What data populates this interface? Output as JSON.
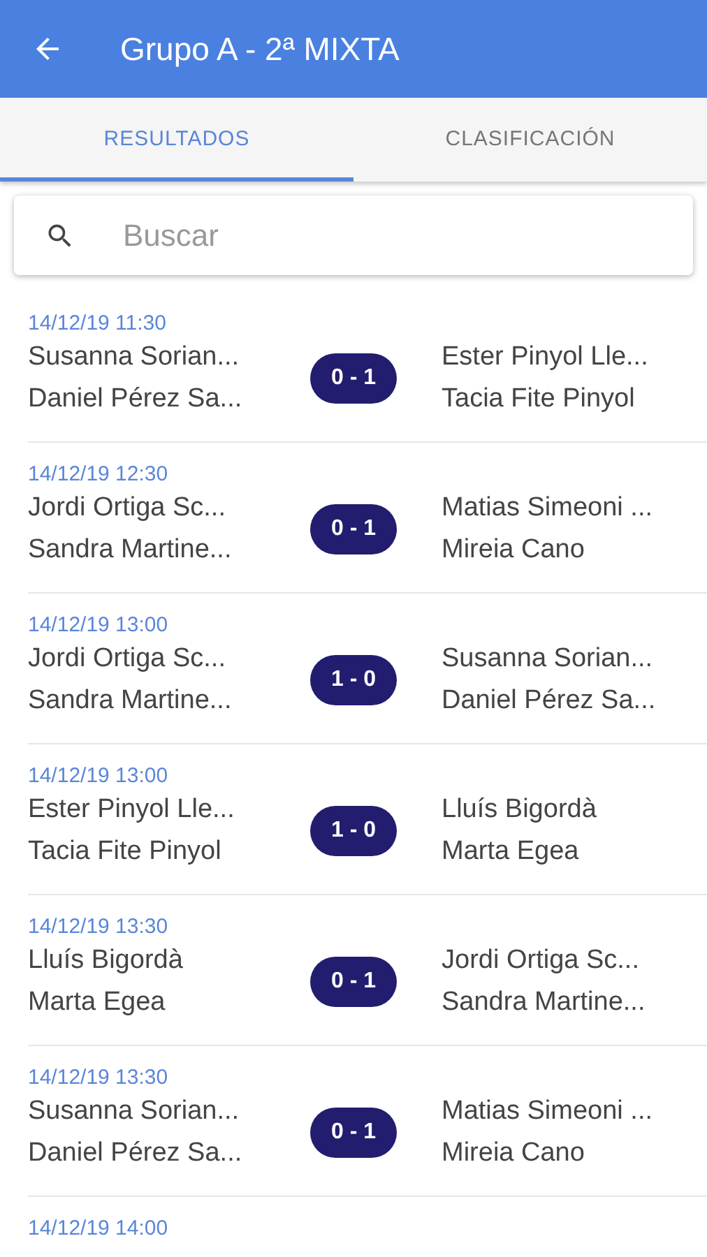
{
  "app_bar": {
    "title": "Grupo A - 2ª MIXTA"
  },
  "tabs": [
    {
      "label": "RESULTADOS",
      "selected": true
    },
    {
      "label": "CLASIFICACIÓN",
      "selected": false
    }
  ],
  "search": {
    "placeholder": "Buscar"
  },
  "matches": [
    {
      "datetime": "14/12/19 11:30",
      "home": [
        "Susanna Sorian...",
        "Daniel Pérez Sa..."
      ],
      "score": "0 - 1",
      "away": [
        "Ester Pinyol Lle...",
        "Tacia Fite Pinyol"
      ]
    },
    {
      "datetime": "14/12/19 12:30",
      "home": [
        "Jordi Ortiga Sc...",
        "Sandra Martine..."
      ],
      "score": "0 - 1",
      "away": [
        "Matias Simeoni ...",
        "Mireia Cano"
      ]
    },
    {
      "datetime": "14/12/19 13:00",
      "home": [
        "Jordi Ortiga Sc...",
        "Sandra Martine..."
      ],
      "score": "1 - 0",
      "away": [
        "Susanna Sorian...",
        "Daniel Pérez Sa..."
      ]
    },
    {
      "datetime": "14/12/19 13:00",
      "home": [
        "Ester Pinyol Lle...",
        "Tacia Fite Pinyol"
      ],
      "score": "1 - 0",
      "away": [
        "Lluís Bigordà",
        "Marta Egea"
      ]
    },
    {
      "datetime": "14/12/19 13:30",
      "home": [
        "Lluís Bigordà",
        "Marta Egea"
      ],
      "score": "0 - 1",
      "away": [
        "Jordi Ortiga Sc...",
        "Sandra Martine..."
      ]
    },
    {
      "datetime": "14/12/19 13:30",
      "home": [
        "Susanna Sorian...",
        "Daniel Pérez Sa..."
      ],
      "score": "0 - 1",
      "away": [
        "Matias Simeoni ...",
        "Mireia Cano"
      ]
    },
    {
      "datetime": "14/12/19 14:00"
    }
  ]
}
